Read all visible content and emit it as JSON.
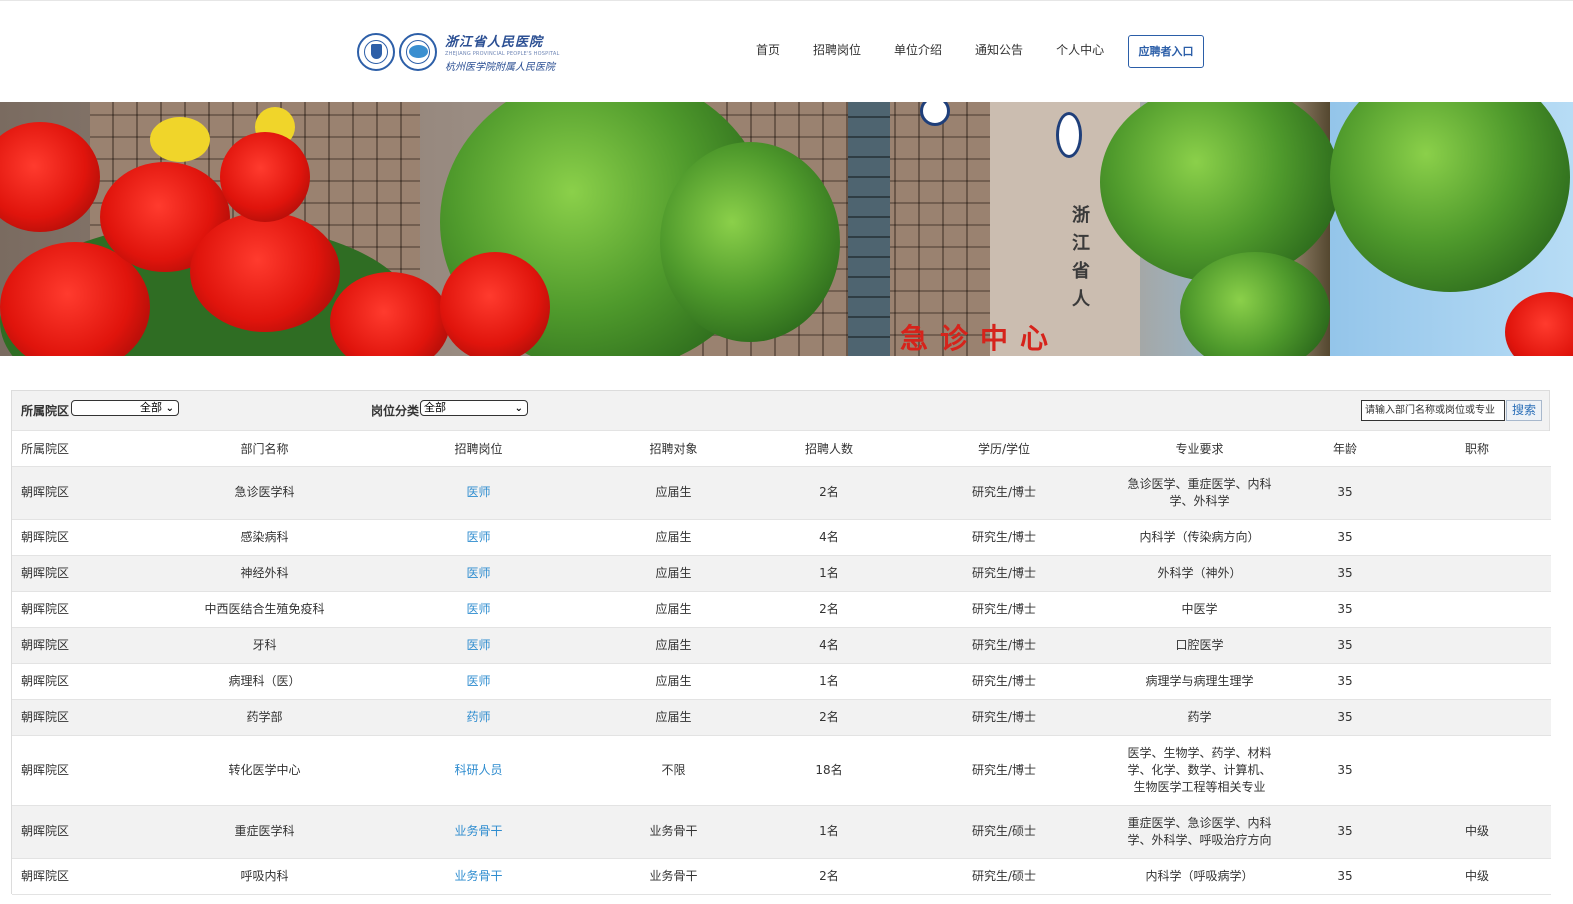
{
  "header": {
    "logo_cn": "浙江省人民医院",
    "logo_en": "ZHEJIANG PROVINCIAL PEOPLE'S HOSPITAL",
    "logo_cn2": "杭州医学院附属人民医院",
    "nav": [
      "首页",
      "招聘岗位",
      "单位介绍",
      "通知公告",
      "个人中心"
    ],
    "apply_button": "应聘者入口"
  },
  "filters": {
    "campus_label": "所属院区",
    "campus_value": "全部",
    "category_label": "岗位分类",
    "category_value": "全部",
    "search_placeholder": "请输入部门名称或岗位或专业",
    "search_button": "搜索"
  },
  "table": {
    "columns": [
      "所属院区",
      "部门名称",
      "招聘岗位",
      "招聘对象",
      "招聘人数",
      "学历/学位",
      "专业要求",
      "年龄",
      "职称"
    ],
    "rows": [
      [
        "朝晖院区",
        "急诊医学科",
        "医师",
        "应届生",
        "2名",
        "研究生/博士",
        "急诊医学、重症医学、内科学、外科学",
        "35",
        ""
      ],
      [
        "朝晖院区",
        "感染病科",
        "医师",
        "应届生",
        "4名",
        "研究生/博士",
        "内科学（传染病方向）",
        "35",
        ""
      ],
      [
        "朝晖院区",
        "神经外科",
        "医师",
        "应届生",
        "1名",
        "研究生/博士",
        "外科学（神外）",
        "35",
        ""
      ],
      [
        "朝晖院区",
        "中西医结合生殖免疫科",
        "医师",
        "应届生",
        "2名",
        "研究生/博士",
        "中医学",
        "35",
        ""
      ],
      [
        "朝晖院区",
        "牙科",
        "医师",
        "应届生",
        "4名",
        "研究生/博士",
        "口腔医学",
        "35",
        ""
      ],
      [
        "朝晖院区",
        "病理科（医）",
        "医师",
        "应届生",
        "1名",
        "研究生/博士",
        "病理学与病理生理学",
        "35",
        ""
      ],
      [
        "朝晖院区",
        "药学部",
        "药师",
        "应届生",
        "2名",
        "研究生/博士",
        "药学",
        "35",
        ""
      ],
      [
        "朝晖院区",
        "转化医学中心",
        "科研人员",
        "不限",
        "18名",
        "研究生/博士",
        "医学、生物学、药学、材料学、化学、数学、计算机、生物医学工程等相关专业",
        "35",
        ""
      ],
      [
        "朝晖院区",
        "重症医学科",
        "业务骨干",
        "业务骨干",
        "1名",
        "研究生/硕士",
        "重症医学、急诊医学、内科学、外科学、呼吸治疗方向",
        "35",
        "中级"
      ],
      [
        "朝晖院区",
        "呼吸内科",
        "业务骨干",
        "业务骨干",
        "2名",
        "研究生/硕士",
        "内科学（呼吸病学）",
        "35",
        "中级"
      ]
    ]
  },
  "banner": {
    "sign_text": "浙江省人",
    "red_sign_text": "急诊中心"
  },
  "colors": {
    "link": "#2e8ccf",
    "accent": "#2b5ea8",
    "row_alt": "#f2f2f2"
  }
}
